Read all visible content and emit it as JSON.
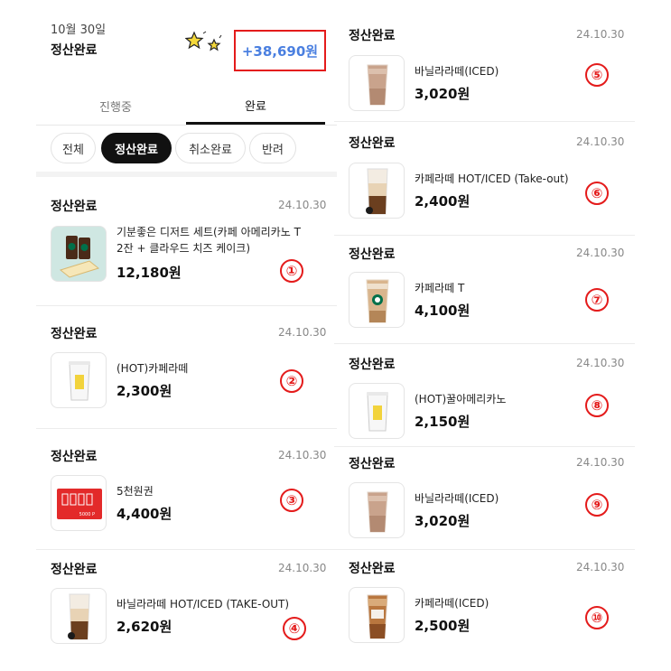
{
  "header": {
    "date": "10월 30일",
    "status": "정산완료",
    "total": "+38,690원"
  },
  "tabs": [
    {
      "label": "진행중",
      "active": false
    },
    {
      "label": "완료",
      "active": true
    }
  ],
  "filters": [
    {
      "label": "전체",
      "active": false
    },
    {
      "label": "정산완료",
      "active": true
    },
    {
      "label": "취소완료",
      "active": false
    },
    {
      "label": "반려",
      "active": false
    }
  ],
  "items": [
    {
      "status": "정산완료",
      "date": "24.10.30",
      "name_line1": "기분좋은 디저트 세트(카페 아메리카노 T",
      "name_line2": "2잔 + 클라우드 치즈 케이크)",
      "price": "12,180원",
      "marker": "①",
      "thumb": "dessert-set-image"
    },
    {
      "status": "정산완료",
      "date": "24.10.30",
      "name_line1": "(HOT)카페라떼",
      "name_line2": "",
      "price": "2,300원",
      "marker": "②",
      "thumb": "hot-cup-image"
    },
    {
      "status": "정산완료",
      "date": "24.10.30",
      "name_line1": "5천원권",
      "name_line2": "",
      "price": "4,400원",
      "marker": "③",
      "thumb": "gift-card-image",
      "card_text": "5000 P"
    },
    {
      "status": "정산완료",
      "date": "24.10.30",
      "name_line1": "바닐라라떼 HOT/ICED (TAKE-OUT)",
      "name_line2": "",
      "price": "2,620원",
      "marker": "④",
      "thumb": "layered-latte-image"
    },
    {
      "status": "정산완료",
      "date": "24.10.30",
      "name_line1": "바닐라라떼(ICED)",
      "name_line2": "",
      "price": "3,020원",
      "marker": "⑤",
      "thumb": "iced-latte-image"
    },
    {
      "status": "정산완료",
      "date": "24.10.30",
      "name_line1": "카페라떼 HOT/ICED (Take-out)",
      "name_line2": "",
      "price": "2,400원",
      "marker": "⑥",
      "thumb": "layered-latte-image"
    },
    {
      "status": "정산완료",
      "date": "24.10.30",
      "name_line1": "카페라떼 T",
      "name_line2": "",
      "price": "4,100원",
      "marker": "⑦",
      "thumb": "starbucks-latte-image"
    },
    {
      "status": "정산완료",
      "date": "24.10.30",
      "name_line1": "(HOT)꿀아메리카노",
      "name_line2": "",
      "price": "2,150원",
      "marker": "⑧",
      "thumb": "hot-cup-image"
    },
    {
      "status": "정산완료",
      "date": "24.10.30",
      "name_line1": "바닐라라떼(ICED)",
      "name_line2": "",
      "price": "3,020원",
      "marker": "⑨",
      "thumb": "iced-latte-image"
    },
    {
      "status": "정산완료",
      "date": "24.10.30",
      "name_line1": "카페라떼(ICED)",
      "name_line2": "",
      "price": "2,500원",
      "marker": "⑩",
      "thumb": "iced-coffee-image"
    }
  ],
  "colors": {
    "accent_blue": "#4a7fe0",
    "annotation_red": "#e41b1b",
    "active_chip": "#111111"
  }
}
